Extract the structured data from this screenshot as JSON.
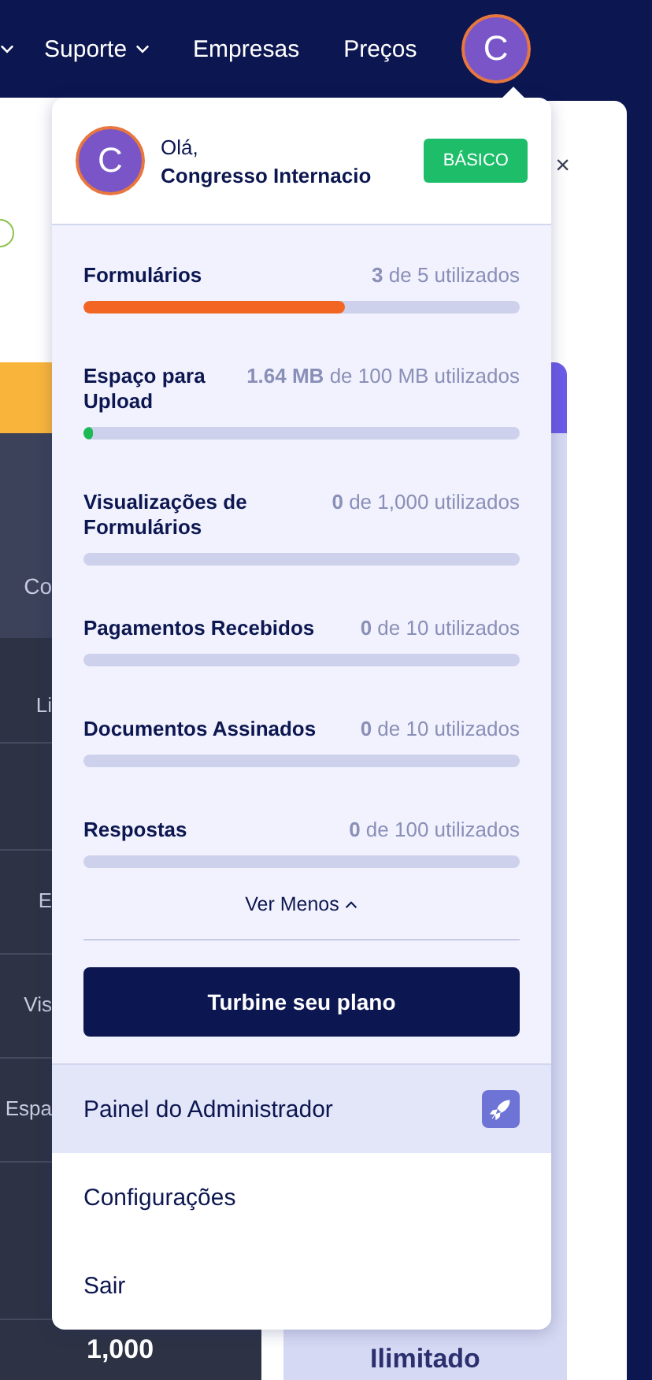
{
  "nav": {
    "items": [
      {
        "label": "Suporte",
        "kind": "dropdown"
      },
      {
        "label": "Empresas",
        "kind": "link"
      },
      {
        "label": "Preços",
        "kind": "link"
      }
    ],
    "avatar": "C"
  },
  "background": {
    "close": "×",
    "left_labels": [
      "Co",
      "Li",
      "E",
      "Vis",
      "Espa"
    ],
    "left_value": "1,000",
    "plan_column": "Ilimitado"
  },
  "menu": {
    "avatar": "C",
    "greeting": "Olá,",
    "name": "Congresso Internacio",
    "plan_badge": "BÁSICO",
    "usage": [
      {
        "label": "Formulários",
        "value": "**3** de 5 utilizados",
        "level": 0.6,
        "color": "#f26522"
      },
      {
        "label": "Espaço para Upload",
        "value": "**1.64 MB** de 100 MB utilizados",
        "level": 0.0164,
        "color": "#1db954"
      },
      {
        "label": "Visualizações de Formulários",
        "value": "**0** de 1,000 utilizados"
      },
      {
        "label": "Pagamentos Recebidos",
        "value": "**0** de 10 utilizados"
      },
      {
        "label": "Documentos Assinados",
        "value": "**0** de 10 utilizados"
      },
      {
        "label": "Respostas",
        "value": "**0** de 100 utilizados"
      }
    ],
    "toggle": "Ver Menos",
    "upgrade_button": "Turbine seu plano",
    "links": [
      {
        "label": "Painel do Administrador",
        "selected": true,
        "kind": "admin"
      },
      {
        "label": "Configurações",
        "selected": false,
        "kind": "plain"
      },
      {
        "label": "Sair",
        "selected": false,
        "kind": "plain"
      }
    ]
  }
}
